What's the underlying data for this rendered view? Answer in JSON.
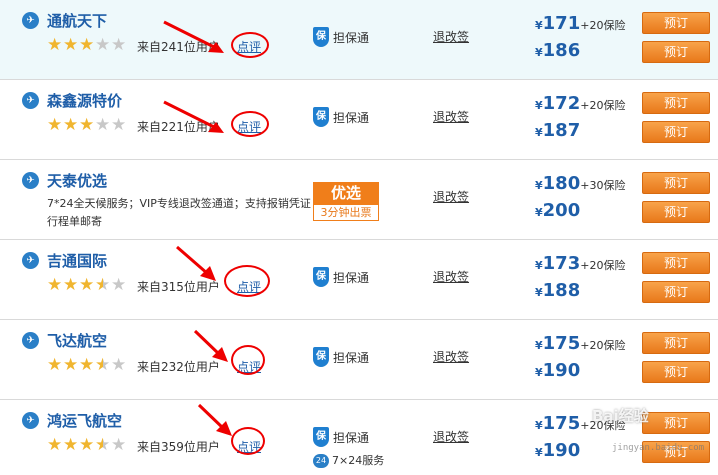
{
  "rows": [
    {
      "name": "通航天下",
      "agent_icon": "plane-globe-icon",
      "stars": 3,
      "star_max": 5,
      "from_text": "来自241位用户",
      "review": "点评",
      "guarantee": "担保通",
      "refund": "退改签",
      "price1": "171",
      "extra1": "+20保险",
      "price2": "186",
      "book": "预订"
    },
    {
      "name": "森鑫源特价",
      "stars": 3,
      "star_max": 5,
      "from_text": "来自221位用户",
      "review": "点评",
      "guarantee": "担保通",
      "refund": "退改签",
      "price1": "172",
      "extra1": "+20保险",
      "price2": "187",
      "book": "预订"
    },
    {
      "name": "天泰优选",
      "desc": "7*24全天候服务；VIP专线退改签通道；支持报销凭证行程单邮寄",
      "badge_top": "优选",
      "badge_bottom": "3分钟出票",
      "refund": "退改签",
      "price1": "180",
      "extra1": "+30保险",
      "price2": "200",
      "book": "预订"
    },
    {
      "name": "吉通国际",
      "stars": 3.5,
      "star_max": 5,
      "from_text": "来自315位用户",
      "review": "点评",
      "guarantee": "担保通",
      "refund": "退改签",
      "price1": "173",
      "extra1": "+20保险",
      "price2": "188",
      "book": "预订"
    },
    {
      "name": "飞达航空",
      "stars": 3.5,
      "star_max": 5,
      "from_text": "来自232位用户",
      "review": "点评",
      "guarantee": "担保通",
      "refund": "退改签",
      "price1": "175",
      "extra1": "+20保险",
      "price2": "190",
      "book": "预订"
    },
    {
      "name": "鸿运飞航空",
      "stars": 3.5,
      "star_max": 5,
      "from_text": "来自359位用户",
      "review": "点评",
      "guarantee": "担保通",
      "service": "7×24服务",
      "refund": "退改签",
      "price1": "175",
      "extra1": "+20保险",
      "price2": "190",
      "book": "预订"
    }
  ],
  "currency": "¥",
  "guarantee_icon_text": "保",
  "service_icon_text": "24",
  "watermark": "Bai经验",
  "watermark_sub": "jingyan.baidu.com",
  "colors": {
    "accent": "#1f5ea8",
    "button": "#f08c2a",
    "annotation": "#e00000",
    "highlight_row": "#eef9fb"
  }
}
